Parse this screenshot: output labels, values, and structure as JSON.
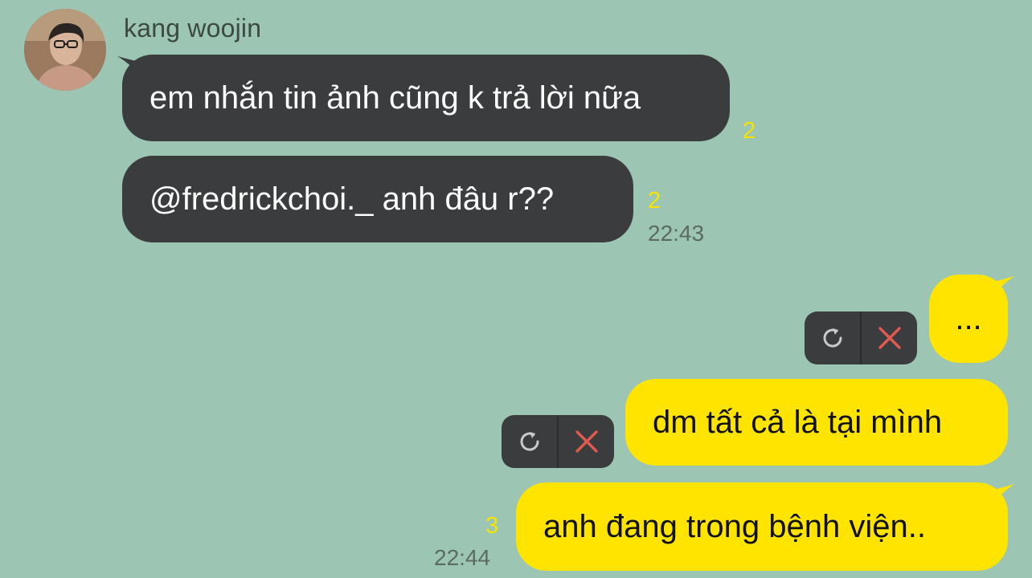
{
  "chat": {
    "sender_name": "kang woojin",
    "incoming": [
      {
        "text": "em nhắn tin ảnh cũng k trả lời nữa",
        "unread": "2"
      },
      {
        "text": "@fredrickchoi._ anh đâu r??",
        "unread": "2",
        "time": "22:43"
      }
    ],
    "outgoing": [
      {
        "text": "...",
        "status": "failed"
      },
      {
        "text": "dm tất cả là tại mình",
        "status": "failed"
      },
      {
        "text": "anh đang trong bệnh viện..",
        "unread": "3",
        "time": "22:44"
      }
    ],
    "icons": {
      "retry": "retry-icon",
      "delete": "close-icon",
      "avatar": "profile-photo"
    },
    "colors": {
      "background": "#9dc5b3",
      "incoming_bubble": "#3a3c3e",
      "outgoing_bubble": "#ffe400",
      "unread_count": "#f6e400",
      "delete_icon": "#e05a4f"
    }
  }
}
